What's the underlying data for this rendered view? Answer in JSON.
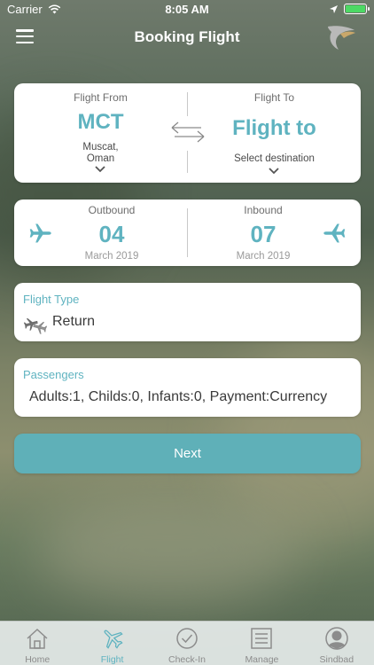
{
  "status_bar": {
    "carrier": "Carrier",
    "time": "8:05 AM",
    "battery_level": 1.0
  },
  "nav": {
    "title": "Booking Flight",
    "menu_icon": "hamburger-icon",
    "logo": "airline-logo"
  },
  "route": {
    "from_label": "Flight From",
    "from_code": "MCT",
    "from_city_line1": "Muscat,",
    "from_city_line2": "Oman",
    "to_label": "Flight To",
    "to_code": "Flight to",
    "to_sub": "Select destination",
    "swap_icon": "swap-arrows-icon"
  },
  "dates": {
    "outbound_label": "Outbound",
    "outbound_day": "04",
    "outbound_month": "March 2019",
    "inbound_label": "Inbound",
    "inbound_day": "07",
    "inbound_month": "March 2019"
  },
  "flight_type": {
    "label": "Flight Type",
    "value": "Return"
  },
  "passengers": {
    "label": "Passengers",
    "value": "Adults:1, Childs:0, Infants:0, Payment:Currency"
  },
  "next_button": {
    "label": "Next"
  },
  "tabs": [
    {
      "label": "Home",
      "icon": "home-icon",
      "active": false
    },
    {
      "label": "Flight",
      "icon": "plane-icon",
      "active": true
    },
    {
      "label": "Check-In",
      "icon": "checkmark-circle-icon",
      "active": false
    },
    {
      "label": "Manage",
      "icon": "list-document-icon",
      "active": false
    },
    {
      "label": "Sindbad",
      "icon": "user-icon",
      "active": false
    }
  ],
  "colors": {
    "accent": "#5fb3c0",
    "button": "#5fb0b8",
    "battery": "#4cd964"
  }
}
